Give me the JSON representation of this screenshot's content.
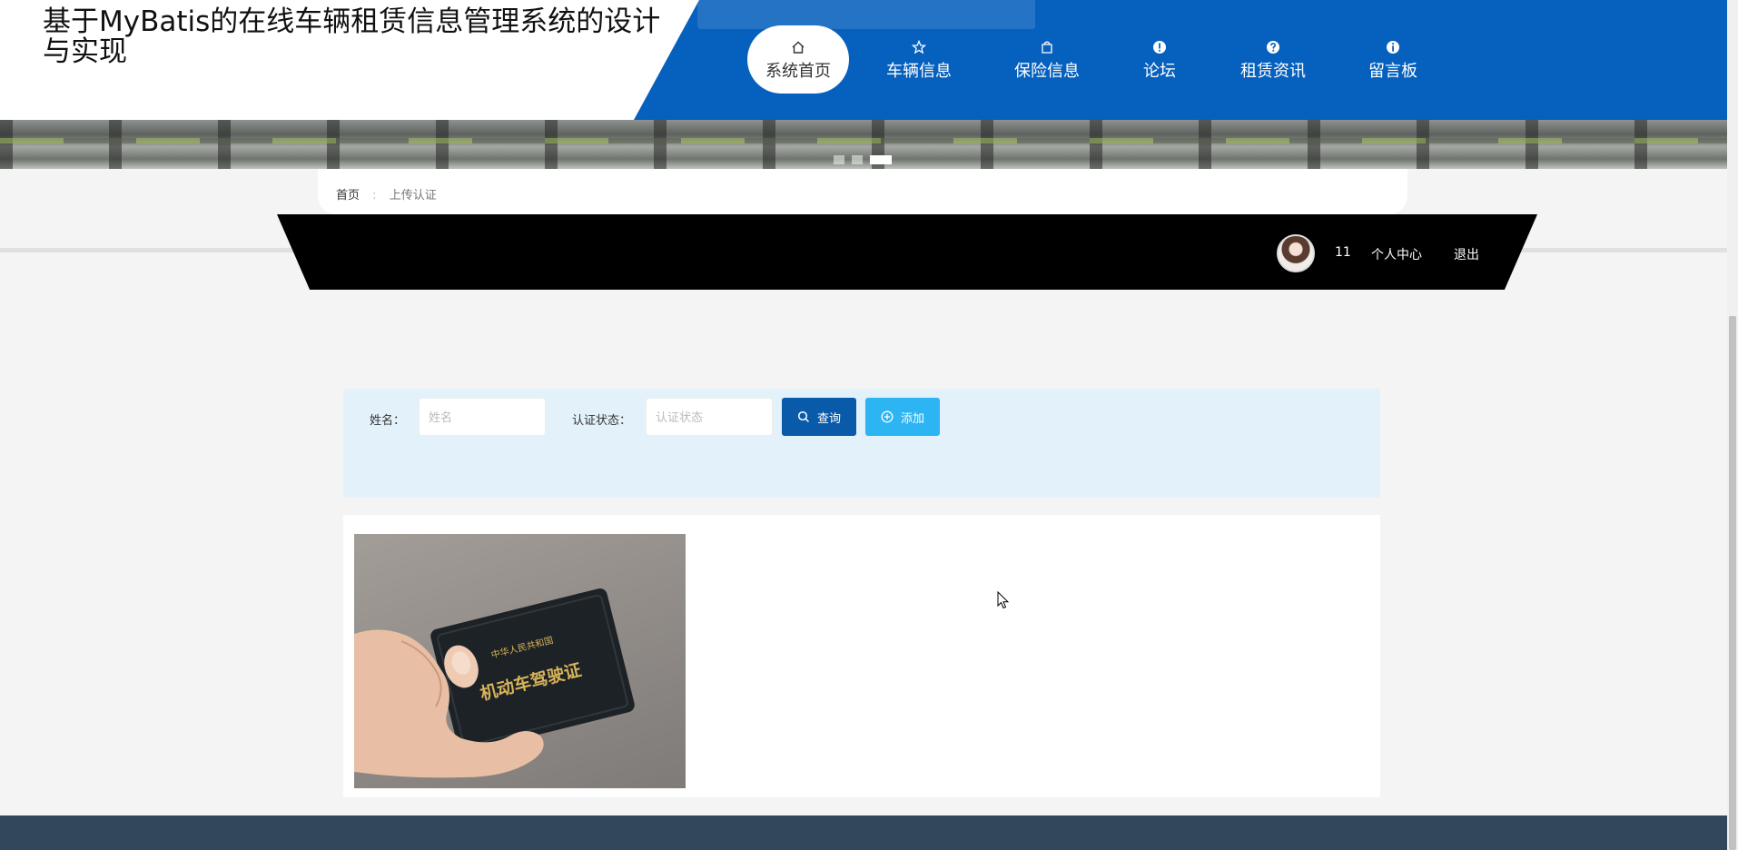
{
  "header": {
    "site_title": "基于MyBatis的在线车辆租赁信息管理系统的设计与实现",
    "colors": {
      "nav_bg": "#0660bd",
      "active_bg": "#ffffff"
    },
    "nav": [
      {
        "label": "系统首页",
        "icon": "home-icon",
        "active": true
      },
      {
        "label": "车辆信息",
        "icon": "star-icon",
        "active": false
      },
      {
        "label": "保险信息",
        "icon": "bag-icon",
        "active": false
      },
      {
        "label": "论坛",
        "icon": "exclamation-icon",
        "active": false
      },
      {
        "label": "租赁资讯",
        "icon": "question-icon",
        "active": false
      },
      {
        "label": "留言板",
        "icon": "info-icon",
        "active": false
      }
    ]
  },
  "banner": {
    "slides": 3,
    "active_slide": 3
  },
  "breadcrumb": {
    "home": "首页",
    "separator": ":",
    "current": "上传认证"
  },
  "user": {
    "name": "11",
    "profile_link": "个人中心",
    "logout_link": "退出"
  },
  "search": {
    "name_label": "姓名：",
    "name_placeholder": "姓名",
    "status_label": "认证状态：",
    "status_placeholder": "认证状态",
    "query_button": "查询",
    "add_button": "添加",
    "colors": {
      "panel_bg": "#e3f1fb",
      "query_bg": "#0a5aaa",
      "add_bg": "#2cb5f2"
    }
  },
  "results": [
    {
      "image_icon": "driver-license-photo",
      "card_text_top": "中华人民共和国",
      "card_text_main": "机动车驾驶证"
    }
  ],
  "footer": {
    "color": "#33475b"
  }
}
